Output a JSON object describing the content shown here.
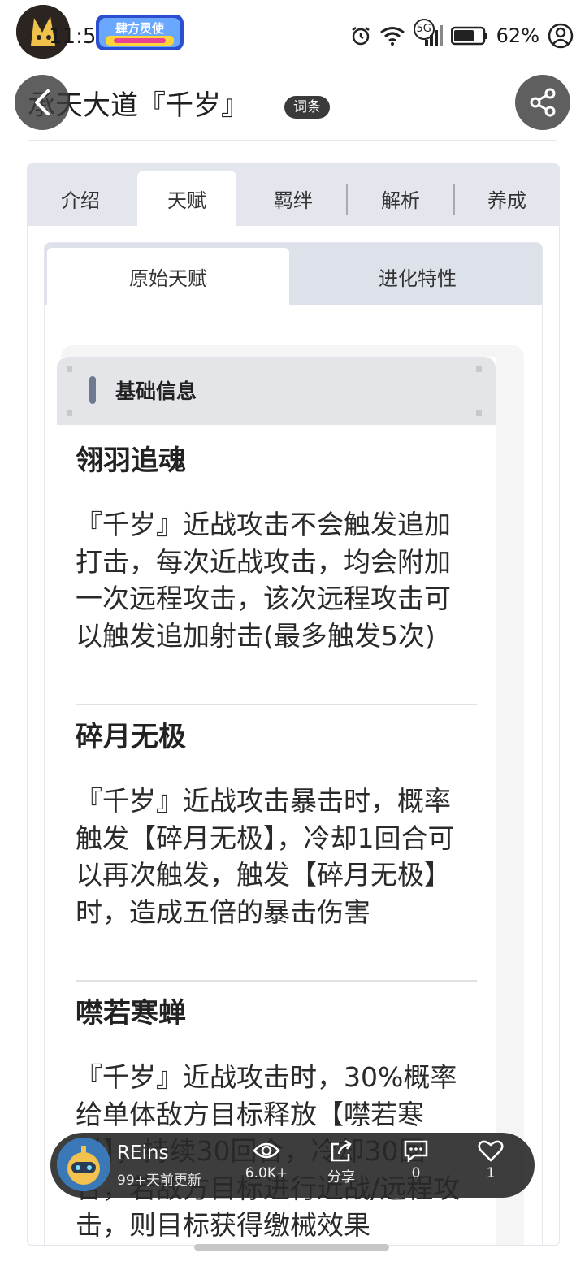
{
  "status_bar": {
    "time": "11:54",
    "game_logo_text": "肆方灵使",
    "network_label": "5G",
    "battery_percent": "62%"
  },
  "header": {
    "title": "承天大道『千岁』",
    "badge": "词条"
  },
  "tabs": {
    "items": [
      "介绍",
      "天赋",
      "羁绊",
      "解析",
      "养成"
    ],
    "active_index": 1
  },
  "subtabs": {
    "items": [
      "原始天赋",
      "进化特性"
    ],
    "active_index": 0
  },
  "info_section": {
    "heading": "基础信息",
    "talents": [
      {
        "name": "翎羽追魂",
        "description": "『千岁』近战攻击不会触发追加打击，每次近战攻击，均会附加一次远程攻击，该次远程攻击可以触发追加射击(最多触发5次)"
      },
      {
        "name": "碎月无极",
        "description": "『千岁』近战攻击暴击时，概率触发【碎月无极】，冷却1回合可以再次触发，触发【碎月无极】时，造成五倍的暴击伤害"
      },
      {
        "name": "噤若寒蝉",
        "description": "『千岁』近战攻击时，30%概率给单体敌方目标释放【噤若寒蝉】，持续30回合，冷却30回合，若敌方目标进行近战/远程攻击，则目标获得缴械效果"
      }
    ]
  },
  "author_bar": {
    "name": "REins",
    "updated": "99+天前更新",
    "views": "6.0K+",
    "share_label": "分享",
    "comments": "0",
    "likes": "1"
  },
  "colors": {
    "tab_bar_bg": "#e3e6ed",
    "info_head_bg": "#e4e5e8",
    "accent_bar": "#6f7a92",
    "float_bar_bg": "#282828"
  }
}
